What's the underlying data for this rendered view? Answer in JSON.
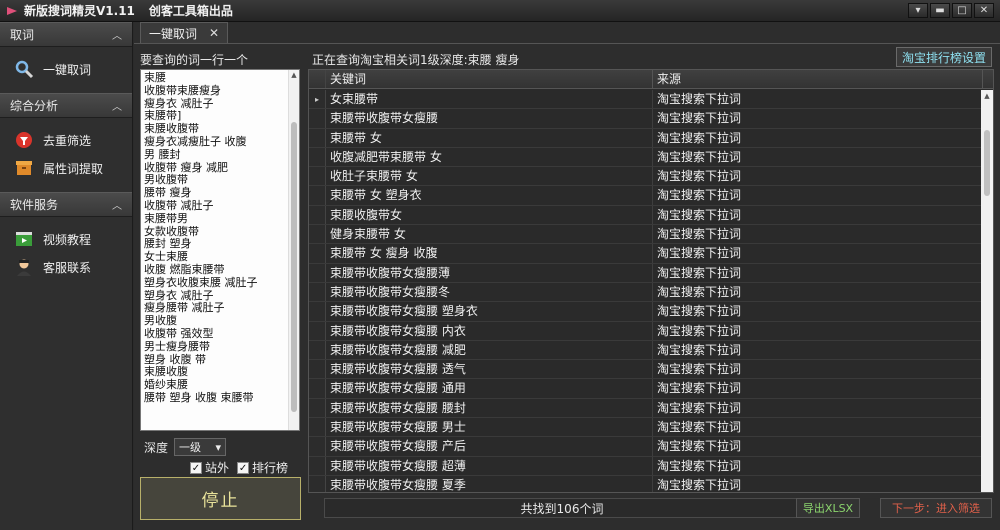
{
  "window": {
    "title": "新版搜词精灵V1.11",
    "subtitle": "创客工具箱出品",
    "buttons": {
      "menu": "▾",
      "minimize": "▬",
      "maximize": "□",
      "close": "✕"
    }
  },
  "nav": {
    "sections": [
      {
        "title": "取词",
        "items": [
          {
            "label": "一键取词",
            "icon": "search-icon"
          }
        ]
      },
      {
        "title": "综合分析",
        "items": [
          {
            "label": "去重筛选",
            "icon": "filter-icon"
          },
          {
            "label": "属性词提取",
            "icon": "box-icon"
          }
        ]
      },
      {
        "title": "软件服务",
        "items": [
          {
            "label": "视频教程",
            "icon": "video-icon"
          },
          {
            "label": "客服联系",
            "icon": "support-icon"
          }
        ]
      }
    ],
    "chevron": "︿"
  },
  "tab": {
    "label": "一键取词",
    "close": "✕"
  },
  "left_panel": {
    "label": "要查询的词一行一个",
    "keywords": [
      "束腰",
      "收腹带束腰瘦身",
      "瘦身衣 减肚子",
      "束腰带]",
      "束腰收腹带",
      "瘦身衣减瘦肚子 收腹",
      "男 腰封",
      "收腹带 瘦身 减肥",
      "男收腹带",
      "腰带 瘦身",
      "收腹带 减肚子",
      "束腰带男",
      "女款收腹带",
      "腰封 塑身",
      "女士束腰",
      "收腹 燃脂束腰带",
      "塑身衣收腹束腰 减肚子",
      "塑身衣 减肚子",
      "瘦身腰带 减肚子",
      "男收腹",
      "收腹带 强效型",
      "男士瘦身腰带",
      "塑身 收腹 带",
      "束腰收腹",
      "婚纱束腰",
      "腰带 塑身 收腹 束腰带"
    ],
    "depth_label": "深度",
    "depth_value": "一级",
    "checkbox_site": "站外",
    "checkbox_rank": "排行榜",
    "checkmark": "✓",
    "stop_label": "停止"
  },
  "status": {
    "text": "正在查询淘宝相关词1级深度:束腰 瘦身"
  },
  "rank_settings_label": "淘宝排行榜设置",
  "grid": {
    "columns": [
      "关键词",
      "来源"
    ],
    "rows": [
      [
        "女束腰带",
        "淘宝搜索下拉词"
      ],
      [
        "束腰带收腹带女瘦腰",
        "淘宝搜索下拉词"
      ],
      [
        "束腰带 女",
        "淘宝搜索下拉词"
      ],
      [
        "收腹减肥带束腰带 女",
        "淘宝搜索下拉词"
      ],
      [
        "收肚子束腰带 女",
        "淘宝搜索下拉词"
      ],
      [
        "束腰带 女 塑身衣",
        "淘宝搜索下拉词"
      ],
      [
        "束腰收腹带女",
        "淘宝搜索下拉词"
      ],
      [
        "健身束腰带 女",
        "淘宝搜索下拉词"
      ],
      [
        "束腰带 女 瘦身 收腹",
        "淘宝搜索下拉词"
      ],
      [
        "束腰带收腹带女瘦腰薄",
        "淘宝搜索下拉词"
      ],
      [
        "束腰带收腹带女瘦腰冬",
        "淘宝搜索下拉词"
      ],
      [
        "束腰带收腹带女瘦腰 塑身衣",
        "淘宝搜索下拉词"
      ],
      [
        "束腰带收腹带女瘦腰 内衣",
        "淘宝搜索下拉词"
      ],
      [
        "束腰带收腹带女瘦腰 减肥",
        "淘宝搜索下拉词"
      ],
      [
        "束腰带收腹带女瘦腰 透气",
        "淘宝搜索下拉词"
      ],
      [
        "束腰带收腹带女瘦腰 通用",
        "淘宝搜索下拉词"
      ],
      [
        "束腰带收腹带女瘦腰 腰封",
        "淘宝搜索下拉词"
      ],
      [
        "束腰带收腹带女瘦腰 男士",
        "淘宝搜索下拉词"
      ],
      [
        "束腰带收腹带女瘦腰 产后",
        "淘宝搜索下拉词"
      ],
      [
        "束腰带收腹带女瘦腰 超薄",
        "淘宝搜索下拉词"
      ],
      [
        "束腰带收腹带女瘦腰 夏季",
        "淘宝搜索下拉词"
      ]
    ],
    "selected_marker": "▸"
  },
  "bottom": {
    "count_text": "共找到106个词",
    "export_label": "导出XLSX",
    "next_label": "下一步：进入筛选"
  },
  "colors": {
    "accent_rank": "#8ee0f0",
    "export": "#8bd46d",
    "next": "#e0604a",
    "stop": "#e9e39a"
  }
}
